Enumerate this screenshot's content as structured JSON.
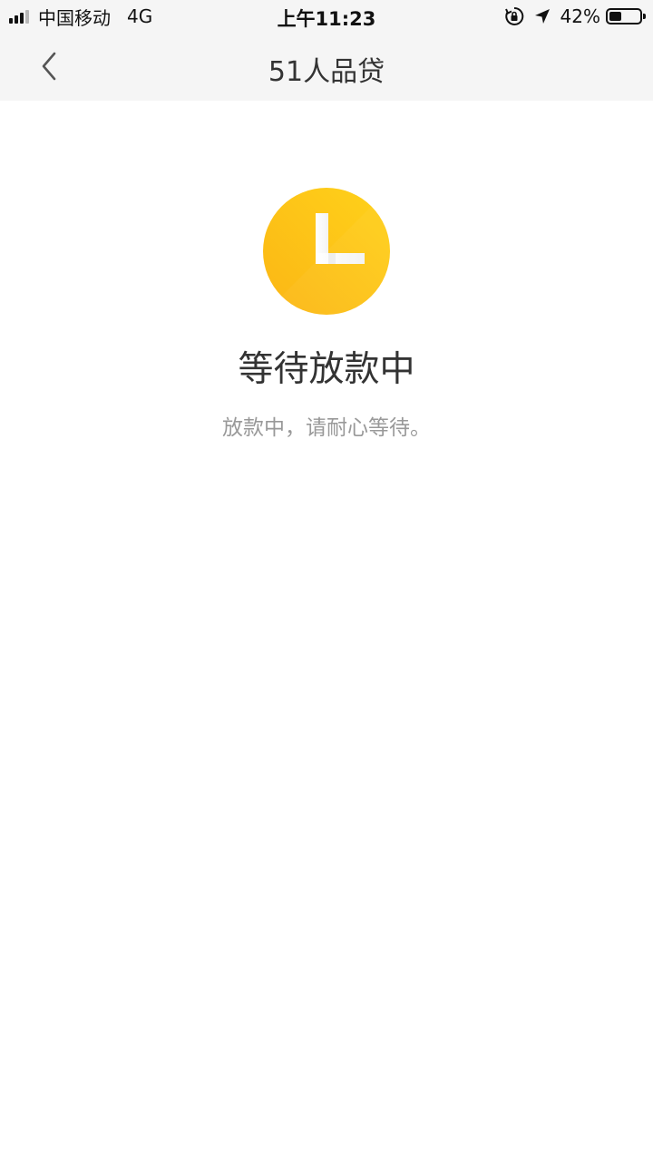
{
  "status_bar": {
    "carrier": "中国移动",
    "network": "4G",
    "time": "上午11:23",
    "battery_percent": "42%",
    "battery_level": 0.42,
    "icons": [
      "signal-icon",
      "orientation-lock-icon",
      "location-arrow-icon",
      "battery-icon"
    ]
  },
  "nav": {
    "title": "51人品贷",
    "back_icon": "chevron-left-icon"
  },
  "status": {
    "icon": "clock-icon",
    "icon_color": "#FDC116",
    "title": "等待放款中",
    "description": "放款中，请耐心等待。"
  },
  "colors": {
    "nav_background": "#f5f5f5",
    "title_text": "#333333",
    "secondary_text": "#999999",
    "accent": "#FDC116"
  }
}
